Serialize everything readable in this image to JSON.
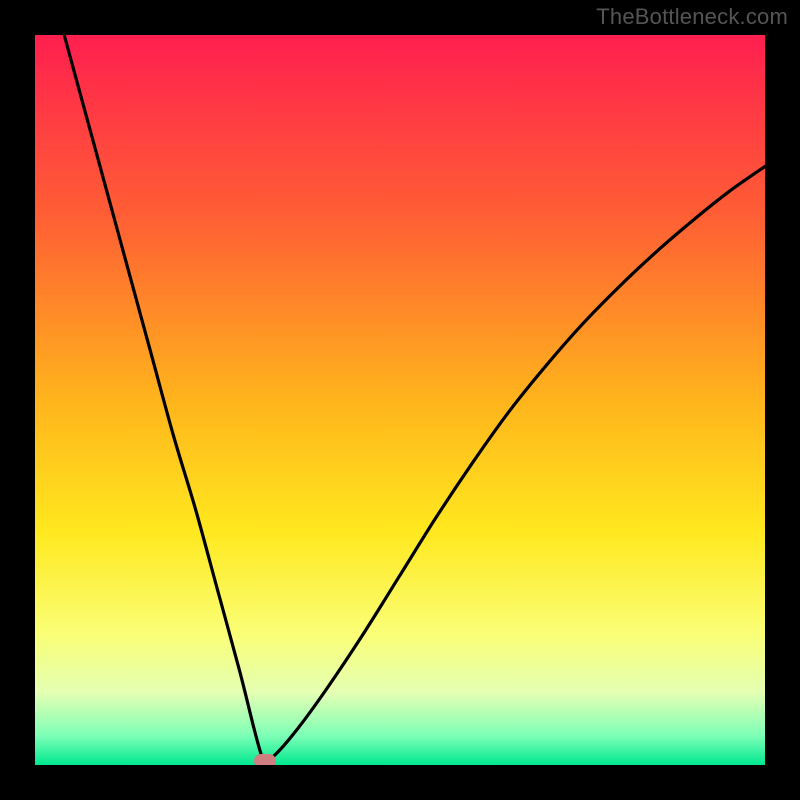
{
  "watermark": "TheBottleneck.com",
  "chart_data": {
    "type": "line",
    "title": "",
    "xlabel": "",
    "ylabel": "",
    "xlim": [
      0,
      100
    ],
    "ylim": [
      0,
      100
    ],
    "grid": false,
    "legend": false,
    "gradient_stops": [
      {
        "offset": 0.0,
        "color": "#ff1f4f"
      },
      {
        "offset": 0.25,
        "color": "#ff5f34"
      },
      {
        "offset": 0.5,
        "color": "#ffb41c"
      },
      {
        "offset": 0.68,
        "color": "#ffe81e"
      },
      {
        "offset": 0.82,
        "color": "#faff76"
      },
      {
        "offset": 0.9,
        "color": "#e5ffb3"
      },
      {
        "offset": 0.96,
        "color": "#7dffb6"
      },
      {
        "offset": 1.0,
        "color": "#00e890"
      }
    ],
    "series": [
      {
        "name": "bottleneck-curve",
        "color": "#000000",
        "x": [
          4,
          7,
          10,
          13,
          16,
          19,
          22,
          25,
          28,
          30,
          31,
          31.5,
          33,
          36,
          40,
          45,
          50,
          55,
          60,
          65,
          70,
          75,
          80,
          85,
          90,
          95,
          100
        ],
        "values": [
          100,
          89,
          78,
          67,
          56,
          45,
          35,
          24,
          13,
          5,
          1.4,
          0.5,
          1.5,
          5,
          10.5,
          18,
          26,
          34,
          41.5,
          48.5,
          54.7,
          60.4,
          65.5,
          70.2,
          74.5,
          78.5,
          82
        ]
      }
    ],
    "marker": {
      "x": 31.5,
      "y": 0.5,
      "color": "#cf7f7f"
    }
  }
}
